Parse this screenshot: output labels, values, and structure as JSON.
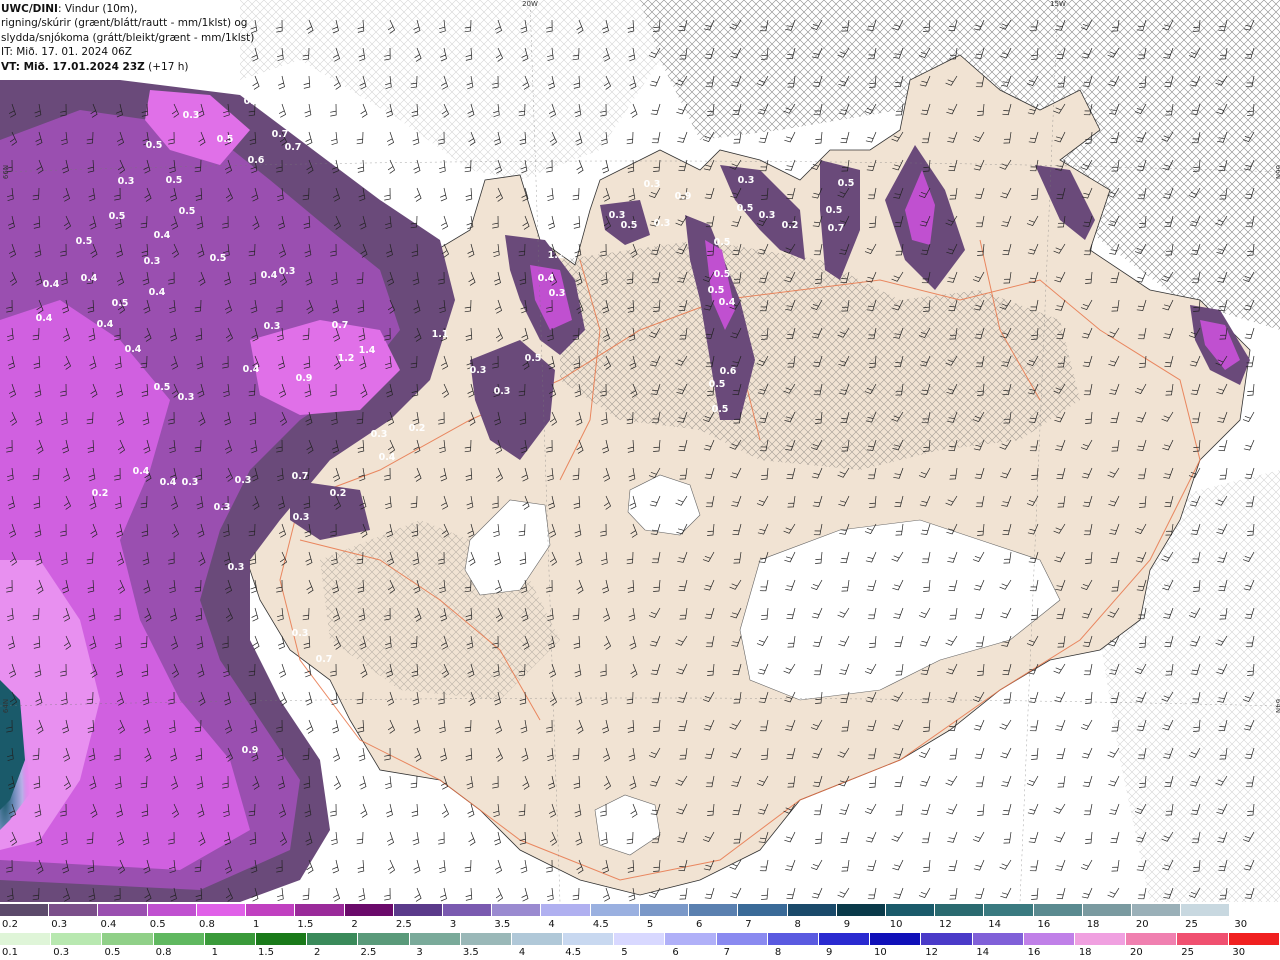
{
  "title": {
    "model": "UWC/DINI",
    "line1_rest": ": Vindur (10m),",
    "line2": "rigning/skúrir (grænt/blátt/rautt - mm/1klst) og",
    "line3": "slydda/snjókoma (grátt/bleikt/grænt - mm/1klst)",
    "line4": "IT: Mið. 17. 01. 2024 06Z",
    "line5_bold": "VT: Mið. 17.01.2024 23Z",
    "line5_rest": " (+17 h)"
  },
  "grid_labels": [
    "20W",
    "15W",
    "66N",
    "66N",
    "64N",
    "64N"
  ],
  "precip_labels": [
    "0.4",
    "0.6",
    "0.3",
    "0.5",
    "0.7",
    "0.7",
    "0.5",
    "0.5",
    "0.3",
    "0.5",
    "0.5",
    "0.6",
    "0.4",
    "0.5",
    "0.3",
    "0.5",
    "0.4",
    "0.4",
    "0.3",
    "0.4",
    "0.4",
    "0.5",
    "0.3",
    "0.7",
    "0.4",
    "0.4",
    "1.2",
    "1.4",
    "0.4",
    "0.9",
    "0.5",
    "0.4",
    "0.3",
    "0.2",
    "0.3",
    "0.4",
    "0.4",
    "0.4",
    "0.3",
    "0.3",
    "0.7",
    "0.2",
    "0.3",
    "0.2",
    "0.3",
    "0.3",
    "0.3",
    "0.7",
    "0.3",
    "0.9",
    "1.2",
    "0.4",
    "0.3",
    "0.5",
    "0.3",
    "0.3",
    "1.1",
    "0.5",
    "0.5",
    "0.5",
    "0.4",
    "0.6",
    "0.9",
    "0.5",
    "0.5",
    "0.3",
    "0.3",
    "0.5",
    "0.3",
    "0.5",
    "0.3",
    "0.2",
    "0.3",
    "0.5",
    "0.5",
    "0.7"
  ],
  "legend_snow": {
    "ticks": [
      "0.2",
      "0.3",
      "0.4",
      "0.5",
      "0.8",
      "1",
      "1.5",
      "2",
      "2.5",
      "3",
      "3.5",
      "4",
      "4.5",
      "5",
      "6",
      "7",
      "8",
      "9",
      "10",
      "12",
      "14",
      "16",
      "18",
      "20",
      "25",
      "30"
    ],
    "colors": [
      "#5c4a6b",
      "#7b4f8a",
      "#9a4fb0",
      "#c050d0",
      "#e060e8",
      "#c040c0",
      "#9a2a9a",
      "#6a0a6a",
      "#5a3a8a",
      "#7a5ab0",
      "#9a8ad0",
      "#b0b0f0",
      "#9ab0e0",
      "#7a98c8",
      "#5a80b0",
      "#3a6a98",
      "#1a4a6a",
      "#0a3a4a",
      "#1a5a6a",
      "#2a6a70",
      "#3a7a80",
      "#5a8a90",
      "#7a9aa0",
      "#9ab0b8",
      "#c8d8e0"
    ]
  },
  "legend_rain": {
    "ticks": [
      "0.1",
      "0.3",
      "0.5",
      "0.8",
      "1",
      "1.5",
      "2",
      "2.5",
      "3",
      "3.5",
      "4",
      "4.5",
      "5",
      "6",
      "7",
      "8",
      "9",
      "10",
      "12",
      "14",
      "16",
      "18",
      "20",
      "25",
      "30"
    ],
    "colors": [
      "#dff5d8",
      "#b8e8b0",
      "#90d088",
      "#60b860",
      "#3a9a3a",
      "#1a7a1a",
      "#3a8a5a",
      "#5a9a7a",
      "#7aaa9a",
      "#9ab8b8",
      "#b0c8d8",
      "#c8d8f0",
      "#d8d8ff",
      "#b0b0f8",
      "#8a8af0",
      "#5a5ae0",
      "#2a2ad0",
      "#1010b8",
      "#4a3ac8",
      "#8060d8",
      "#c080e8",
      "#f0a0e0",
      "#f080b0",
      "#f05070",
      "#f02020"
    ]
  }
}
